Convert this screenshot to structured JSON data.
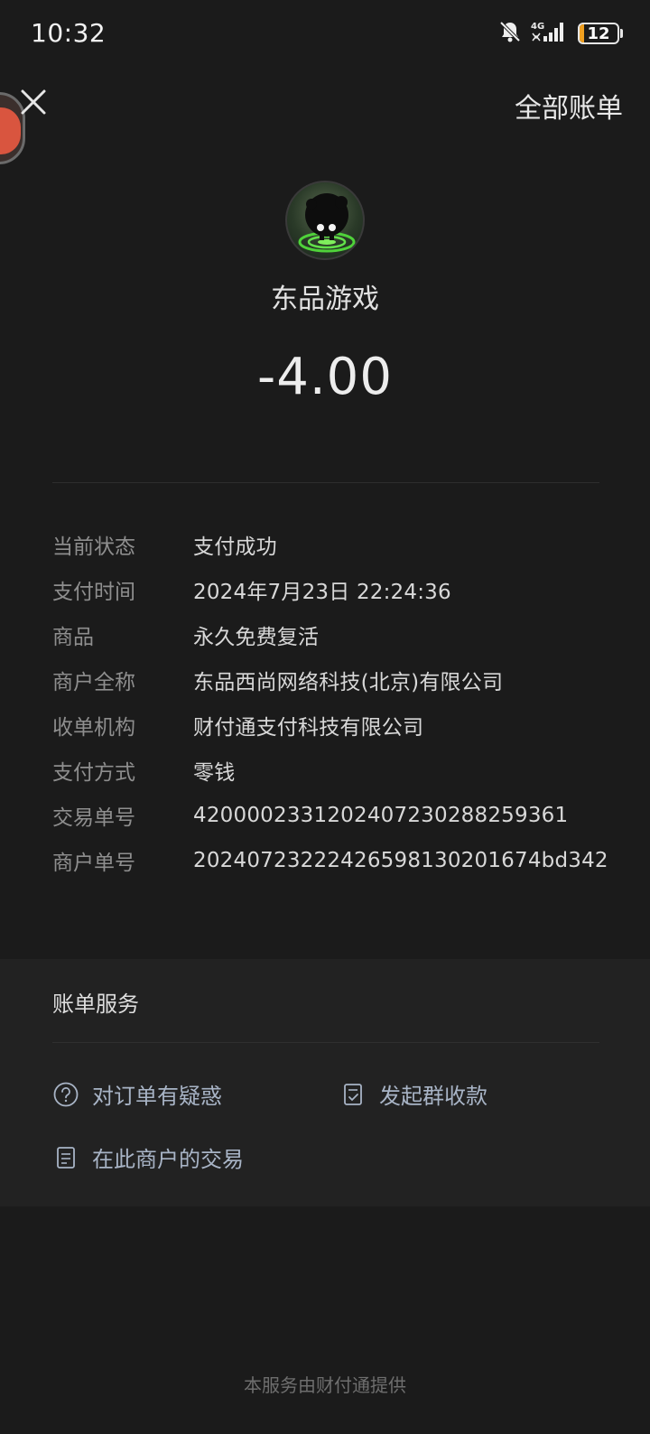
{
  "status_bar": {
    "time": "10:32",
    "network_label": "4G",
    "battery_level": "12",
    "battery_fraction": 0.12,
    "icons": [
      "bell-off-icon",
      "signal-icon",
      "battery-icon"
    ]
  },
  "header": {
    "close_icon": "close-icon",
    "all_bills_label": "全部账单"
  },
  "merchant": {
    "name": "东品游戏",
    "amount": "-4.00"
  },
  "details": [
    {
      "label": "当前状态",
      "value": "支付成功"
    },
    {
      "label": "支付时间",
      "value": "2024年7月23日 22:24:36"
    },
    {
      "label": "商品",
      "value": "永久免费复活"
    },
    {
      "label": "商户全称",
      "value": "东品西尚网络科技(北京)有限公司"
    },
    {
      "label": "收单机构",
      "value": "财付通支付科技有限公司"
    },
    {
      "label": "支付方式",
      "value": "零钱"
    },
    {
      "label": "交易单号",
      "value": "4200002331202407230288259361"
    },
    {
      "label": "商户单号",
      "value": "20240723222426598130201674bd342"
    }
  ],
  "services": {
    "title": "账单服务",
    "items": [
      {
        "label": "对订单有疑惑",
        "icon": "question-circle-icon"
      },
      {
        "label": "发起群收款",
        "icon": "document-check-icon"
      },
      {
        "label": "在此商户的交易",
        "icon": "document-list-icon"
      }
    ]
  },
  "footer": {
    "text": "本服务由财付通提供"
  },
  "colors": {
    "background": "#1b1b1b",
    "card": "#222222",
    "link": "#a8b4c6",
    "battery": "#f0a020"
  }
}
